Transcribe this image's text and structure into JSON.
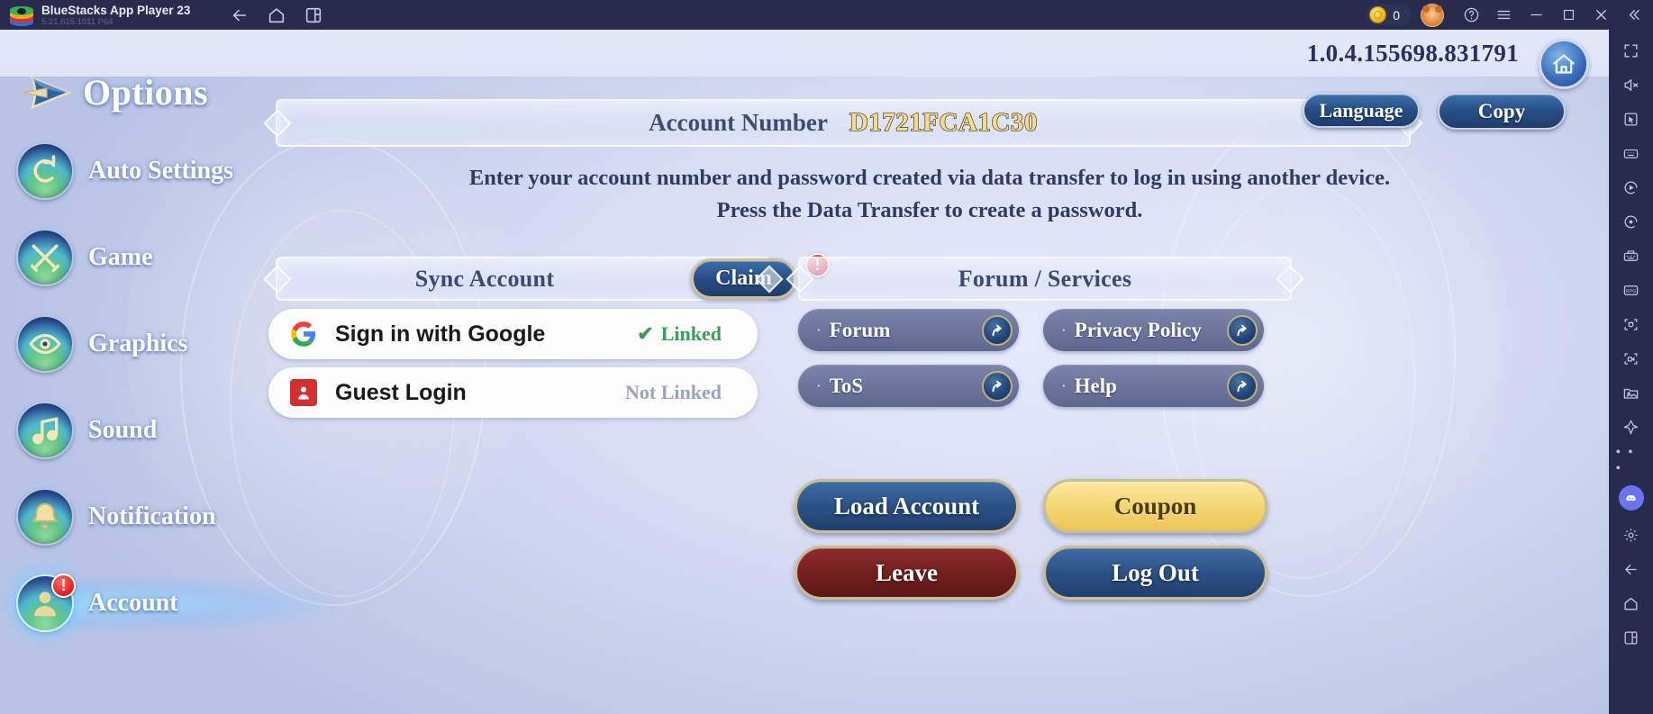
{
  "titlebar": {
    "app_name": "BlueStacks App Player 23",
    "app_version": "5.21.615.1011  P64",
    "icons": [
      "bluestacks-logo-icon",
      "back-icon",
      "home-icon",
      "multi-instance-icon"
    ],
    "coin_count": "0",
    "right_icons": [
      "bear-avatar-icon",
      "help-icon",
      "menu-icon",
      "minimize-icon",
      "maximize-icon",
      "close-icon",
      "collapse-icon"
    ]
  },
  "game_header": {
    "page_title": "Options",
    "app_build_version": "1.0.4.155698.831791",
    "home_button_name": "home-badge-button"
  },
  "sidebar": {
    "items": [
      {
        "label": "Auto Settings",
        "icon": "auto-settings-icon",
        "selected": false,
        "badge": ""
      },
      {
        "label": "Game",
        "icon": "swords-icon",
        "selected": false,
        "badge": ""
      },
      {
        "label": "Graphics",
        "icon": "eye-icon",
        "selected": false,
        "badge": ""
      },
      {
        "label": "Sound",
        "icon": "music-note-icon",
        "selected": false,
        "badge": ""
      },
      {
        "label": "Notification",
        "icon": "bell-icon",
        "selected": false,
        "badge": ""
      },
      {
        "label": "Account",
        "icon": "person-icon",
        "selected": true,
        "badge": "!"
      }
    ]
  },
  "account_panel": {
    "account_number_label": "Account Number",
    "account_number_value": "D1721FCA1C30",
    "language_button": "Language",
    "copy_button": "Copy",
    "instruction_line1": "Enter your account number and password created via data transfer to log in using another device.",
    "instruction_line2": "Press the Data Transfer to create a password."
  },
  "sync_section": {
    "title": "Sync Account",
    "claim_button": "Claim",
    "claim_badge": "!",
    "logins": [
      {
        "label": "Sign in with Google",
        "status": "Linked",
        "state": "linked",
        "icon": "google-icon",
        "check": "✔"
      },
      {
        "label": "Guest Login",
        "status": "Not Linked",
        "state": "not-linked",
        "icon": "guest-account-icon",
        "check": ""
      }
    ]
  },
  "forum_section": {
    "title": "Forum / Services",
    "links": [
      {
        "label": "Forum",
        "bullet": "·",
        "icon": "external-link-icon"
      },
      {
        "label": "Privacy Policy",
        "bullet": "·",
        "icon": "external-link-icon"
      },
      {
        "label": "ToS",
        "bullet": "·",
        "icon": "external-link-icon"
      },
      {
        "label": "Help",
        "bullet": "·",
        "icon": "external-link-icon"
      }
    ]
  },
  "actions": {
    "load_account": "Load Account",
    "coupon": "Coupon",
    "leave": "Leave",
    "log_out": "Log Out"
  },
  "right_rail": {
    "icons": [
      "fullscreen-icon",
      "mute-icon",
      "cursor-icon",
      "keyboard-controls-icon",
      "macro-play-icon",
      "macro-record-icon",
      "keymapping-icon",
      "rpg-mode-icon",
      "screenshot-icon",
      "screen-record-icon",
      "media-manager-icon",
      "plane-boost-icon",
      "more-icon",
      "discord-icon",
      "settings-gear-icon",
      "back-icon",
      "home-icon",
      "recents-icon"
    ]
  },
  "colors": {
    "accent_blue": "#2b5286",
    "gold": "#f5d775",
    "danger_red": "#e01f1f",
    "linked_green": "#3c9d5c",
    "panel_bg": "#d6dcf2"
  }
}
